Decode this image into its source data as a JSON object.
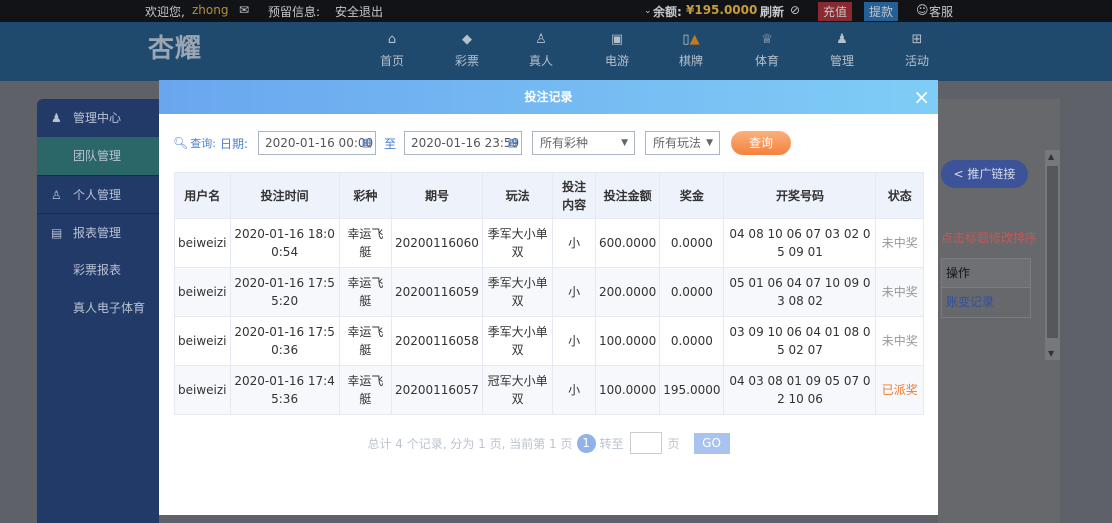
{
  "topbar": {
    "welcome": "欢迎您,",
    "username": "zhong",
    "reserve_info": "预留信息:",
    "logout": "安全退出",
    "balance_label": "余额:",
    "balance": "¥195.0000",
    "refresh": "刷新",
    "deposit": "充值",
    "withdraw": "提款",
    "service": "客服"
  },
  "logo": "杏耀",
  "nav": [
    {
      "label": "首页",
      "icon": "home-icon"
    },
    {
      "label": "彩票",
      "icon": "lottery-icon"
    },
    {
      "label": "真人",
      "icon": "live-icon"
    },
    {
      "label": "电游",
      "icon": "slot-icon"
    },
    {
      "label": "棋牌",
      "icon": "cards-icon"
    },
    {
      "label": "体育",
      "icon": "trophy-icon"
    },
    {
      "label": "管理",
      "icon": "users-icon"
    },
    {
      "label": "活动",
      "icon": "gift-icon"
    }
  ],
  "sidebar": [
    {
      "label": "管理中心"
    },
    {
      "label": "团队管理"
    },
    {
      "label": "个人管理"
    },
    {
      "label": "报表管理"
    },
    {
      "label": "彩票报表"
    },
    {
      "label": "真人电子体育"
    }
  ],
  "right_panel": {
    "promo_link": "推广链接",
    "hint": "点击标题修改排序",
    "op_header": "操作",
    "op_link": "账变记录"
  },
  "modal": {
    "title": "投注记录",
    "query_label": "查询:",
    "date_label": "日期:",
    "date_from": "2020-01-16 00:00",
    "to_label": "至",
    "date_to": "2020-01-16 23:59",
    "lottery_select": "所有彩种",
    "play_select": "所有玩法",
    "query_button": "查询",
    "columns": [
      "用户名",
      "投注时间",
      "彩种",
      "期号",
      "玩法",
      "投注内容",
      "投注金额",
      "奖金",
      "开奖号码",
      "状态"
    ],
    "rows": [
      [
        "beiweizi",
        "2020-01-16 18:00:54",
        "幸运飞艇",
        "20200116060",
        "季军大小单双",
        "小",
        "600.0000",
        "0.0000",
        "04 08 10 06 07 03 02 05 09 01",
        "未中奖"
      ],
      [
        "beiweizi",
        "2020-01-16 17:55:20",
        "幸运飞艇",
        "20200116059",
        "季军大小单双",
        "小",
        "200.0000",
        "0.0000",
        "05 01 06 04 07 10 09 03 08 02",
        "未中奖"
      ],
      [
        "beiweizi",
        "2020-01-16 17:50:36",
        "幸运飞艇",
        "20200116058",
        "季军大小单双",
        "小",
        "100.0000",
        "0.0000",
        "03 09 10 06 04 01 08 05 02 07",
        "未中奖"
      ],
      [
        "beiweizi",
        "2020-01-16 17:45:36",
        "幸运飞艇",
        "20200116057",
        "冠军大小单双",
        "小",
        "100.0000",
        "195.0000",
        "04 03 08 01 09 05 07 02 10 06",
        "已派奖"
      ]
    ],
    "pager": {
      "summary": "总计 4 个记录, 分为 1 页, 当前第 1 页",
      "current": "1",
      "goto": "转至",
      "page_unit": "页",
      "go": "GO"
    }
  }
}
